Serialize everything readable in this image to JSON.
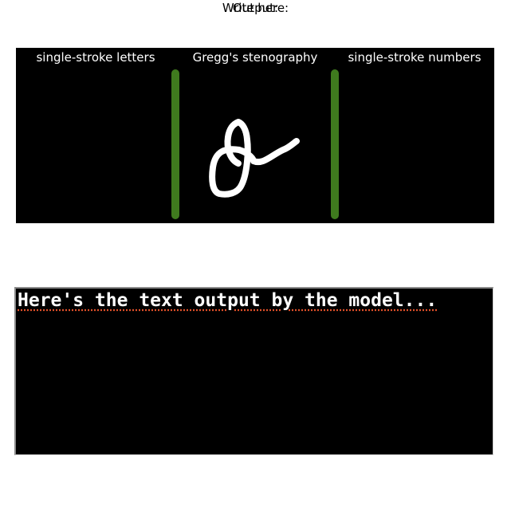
{
  "write_heading": "Write here:",
  "canvas": {
    "zones": [
      {
        "label": "single-stroke letters"
      },
      {
        "label": "Gregg's stenography"
      },
      {
        "label": "single-stroke numbers"
      }
    ],
    "divider_color": "#3f7a1e",
    "ink_color": "#ffffff",
    "background_color": "#000000"
  },
  "output_heading": "Output:",
  "output_text": "Here's the text output by the model...",
  "spellcheck_underline_color": "#e0502a"
}
